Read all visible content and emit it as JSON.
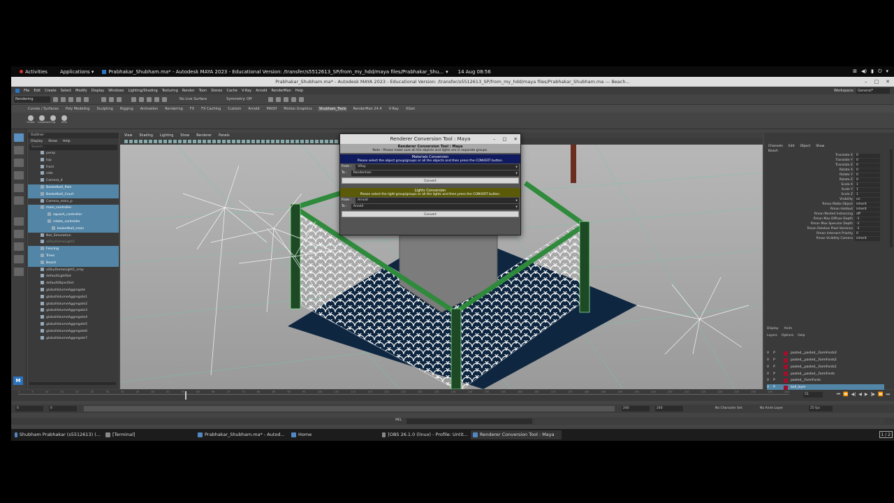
{
  "topbar": {
    "activities": "Activities",
    "applications": "Applications",
    "window_title": "Prabhakar_Shubham.ma* - Autodesk MAYA 2023 - Educational Version: /transfer/s5512613_SP/from_my_hdd/maya files/Prabhakar_Shu...",
    "clock": "14 Aug 08:56"
  },
  "window": {
    "title": "Prabhakar_Shubham.ma* - Autodesk MAYA 2023 - Educational Version: /transfer/s5512613_SP/from_my_hdd/maya files/Prabhakar_Shubham.ma  ---  Beach..."
  },
  "menubar": {
    "items": [
      "File",
      "Edit",
      "Create",
      "Select",
      "Modify",
      "Display",
      "Windows",
      "Lighting/Shading",
      "Texturing",
      "Render",
      "Toon",
      "Stereo",
      "Cache",
      "V-Ray",
      "Arnold",
      "RenderMan",
      "Help"
    ],
    "workspace_label": "Workspace:",
    "workspace_value": "General*"
  },
  "statusline": {
    "mode": "Rendering",
    "live": "No Live Surface",
    "symmetry": "Symmetry: Off"
  },
  "shelf": {
    "tabs": [
      "Curves / Surfaces",
      "Poly Modeling",
      "Sculpting",
      "Rigging",
      "Animation",
      "Rendering",
      "FX",
      "FX Caching",
      "Custom",
      "Arnold",
      "MASH",
      "Motion Graphics",
      "Shubham_Tools",
      "RenderMan 24.4",
      "V-Ray",
      "XGen"
    ],
    "active_tab": "Shubham_Tools",
    "icons": [
      "Center",
      "Constraint",
      "Org",
      "IKFK"
    ]
  },
  "outliner": {
    "title": "Outliner",
    "menu": [
      "Display",
      "Show",
      "Help"
    ],
    "search_placeholder": "Search...",
    "rows": [
      {
        "label": "persp",
        "sel": false,
        "ind": 0
      },
      {
        "label": "top",
        "sel": false,
        "ind": 0
      },
      {
        "label": "front",
        "sel": false,
        "ind": 0
      },
      {
        "label": "side",
        "sel": false,
        "ind": 0
      },
      {
        "label": "Camera_4",
        "sel": false,
        "ind": 0
      },
      {
        "label": "Basketball_Pole",
        "sel": true,
        "ind": 0
      },
      {
        "label": "Basketball_Court",
        "sel": true,
        "ind": 0
      },
      {
        "label": "Camera_main_p",
        "sel": false,
        "ind": 0
      },
      {
        "label": "main_controller",
        "sel": true,
        "ind": 0
      },
      {
        "label": "squash_controller",
        "sel": true,
        "ind": 1
      },
      {
        "label": "rotate_controller",
        "sel": true,
        "ind": 1
      },
      {
        "label": "basketball_main",
        "sel": true,
        "ind": 2
      },
      {
        "label": "Net_Simulation",
        "sel": false,
        "ind": 0
      },
      {
        "label": "aiSkyDomeLight1",
        "sel": false,
        "ind": 0,
        "dim": true
      },
      {
        "label": "Fencing",
        "sel": true,
        "ind": 0
      },
      {
        "label": "Trees",
        "sel": true,
        "ind": 0
      },
      {
        "label": "Beach",
        "sel": true,
        "ind": 0
      },
      {
        "label": "aiSkyDomeLight1_vray",
        "sel": false,
        "ind": 0
      },
      {
        "label": "defaultLightSet",
        "sel": false,
        "ind": 0
      },
      {
        "label": "defaultObjectSet",
        "sel": false,
        "ind": 0
      },
      {
        "label": "globalVolumeAggregate",
        "sel": false,
        "ind": 0
      },
      {
        "label": "globalVolumeAggregate1",
        "sel": false,
        "ind": 0
      },
      {
        "label": "globalVolumeAggregate2",
        "sel": false,
        "ind": 0
      },
      {
        "label": "globalVolumeAggregate3",
        "sel": false,
        "ind": 0
      },
      {
        "label": "globalVolumeAggregate4",
        "sel": false,
        "ind": 0
      },
      {
        "label": "globalVolumeAggregate5",
        "sel": false,
        "ind": 0
      },
      {
        "label": "globalVolumeAggregate6",
        "sel": false,
        "ind": 0
      },
      {
        "label": "globalVolumeAggregate7",
        "sel": false,
        "ind": 0
      }
    ]
  },
  "viewport": {
    "menu": [
      "View",
      "Shading",
      "Lighting",
      "Show",
      "Renderer",
      "Panels"
    ]
  },
  "dialog": {
    "title": "Renderer Conversion Tool : Maya",
    "heading": "Renderer Conversion Tool : Maya",
    "note": "Note : Please make sure all the objects and lights are in separate groups.",
    "materials": {
      "title": "Materials Conversion",
      "instructions": "Please select the object group/groups or all the objects and then press the CONVERT button.",
      "from_label": "From :",
      "from_value": "VRay",
      "to_label": "To :",
      "to_value": "Renderman",
      "button": "Convert"
    },
    "lights": {
      "title": "Lights Conversion",
      "instructions": "Please select the light group/groups or all the lights and then press the CONVERT button.",
      "from_label": "From :",
      "from_value": "Arnold",
      "to_label": "To :",
      "to_value": "Arnold",
      "button": "Convert"
    }
  },
  "channelbox": {
    "menu": [
      "Channels",
      "Edit",
      "Object",
      "Show"
    ],
    "object": "Beach",
    "attrs": [
      {
        "n": "Translate X",
        "v": "0"
      },
      {
        "n": "Translate Y",
        "v": "0"
      },
      {
        "n": "Translate Z",
        "v": "0"
      },
      {
        "n": "Rotate X",
        "v": "0"
      },
      {
        "n": "Rotate Y",
        "v": "0"
      },
      {
        "n": "Rotate Z",
        "v": "0"
      },
      {
        "n": "Scale X",
        "v": "1"
      },
      {
        "n": "Scale Y",
        "v": "1"
      },
      {
        "n": "Scale Z",
        "v": "1"
      },
      {
        "n": "Visibility",
        "v": "on"
      },
      {
        "n": "Rman Matte Object",
        "v": "inherit"
      },
      {
        "n": "Rman Holdout",
        "v": "inherit"
      },
      {
        "n": "Rman Nested Instancing",
        "v": "off"
      },
      {
        "n": "Rman Max Diffuse Depth",
        "v": "-1"
      },
      {
        "n": "Rman Max Specular Depth",
        "v": "-1"
      },
      {
        "n": "Rman Relative Pixel Variance",
        "v": "-1"
      },
      {
        "n": "Rman Intersect Priority",
        "v": "0"
      },
      {
        "n": "Rman Visibility Camera",
        "v": "inherit"
      }
    ]
  },
  "layers": {
    "tabs": [
      "Display",
      "Anim"
    ],
    "menu": [
      "Layers",
      "Options",
      "Help"
    ],
    "rows": [
      {
        "v": "V",
        "p": "P",
        "name": "pasted__pasted__FarmFonts3",
        "sel": false
      },
      {
        "v": "V",
        "p": "P",
        "name": "pasted__pasted__FarmFonts2",
        "sel": false
      },
      {
        "v": "V",
        "p": "P",
        "name": "pasted__pasted__FarmFonts1",
        "sel": false
      },
      {
        "v": "V",
        "p": "P",
        "name": "pasted__pasted__FarmFonts",
        "sel": false
      },
      {
        "v": "V",
        "p": "P",
        "name": "pasted__FarmFonts",
        "sel": false
      },
      {
        "v": "V",
        "p": "P",
        "name": "ball_layer",
        "sel": true
      }
    ]
  },
  "timeline": {
    "ticks": [
      "1",
      "5",
      "10",
      "15",
      "20",
      "25",
      "30",
      "35",
      "40",
      "45",
      "50",
      "55",
      "60",
      "65",
      "70",
      "75",
      "80",
      "85",
      "90",
      "95",
      "100",
      "105",
      "110",
      "115",
      "120",
      "125",
      "130",
      "135",
      "140",
      "145",
      "150",
      "155",
      "160",
      "165",
      "170",
      "175",
      "180",
      "185",
      "190",
      "195",
      "200",
      "205",
      "210",
      "215",
      "220",
      "225",
      "230",
      "235",
      "240"
    ],
    "current_frame": "51"
  },
  "range": {
    "start": "0",
    "start2": "0",
    "end": "240",
    "end2": "240",
    "end3": "240",
    "character": "No Character Set",
    "anim_layer": "No Anim Layer",
    "fps": "25 fps"
  },
  "cmdline": {
    "lang": "MEL"
  },
  "taskbar": {
    "items": [
      {
        "label": "Shubham Prabhakar (s5512613) (...",
        "active": false
      },
      {
        "label": "[Terminal]",
        "active": false
      },
      {
        "label": "Prabhakar_Shubham.ma* - Autod...",
        "active": false
      },
      {
        "label": "Home",
        "active": false
      },
      {
        "label": "[OBS 26.1.0 (linux) - Profile: Untit...",
        "active": false
      },
      {
        "label": "Renderer Conversion Tool : Maya",
        "active": true
      }
    ],
    "pager": "1 / 2"
  }
}
